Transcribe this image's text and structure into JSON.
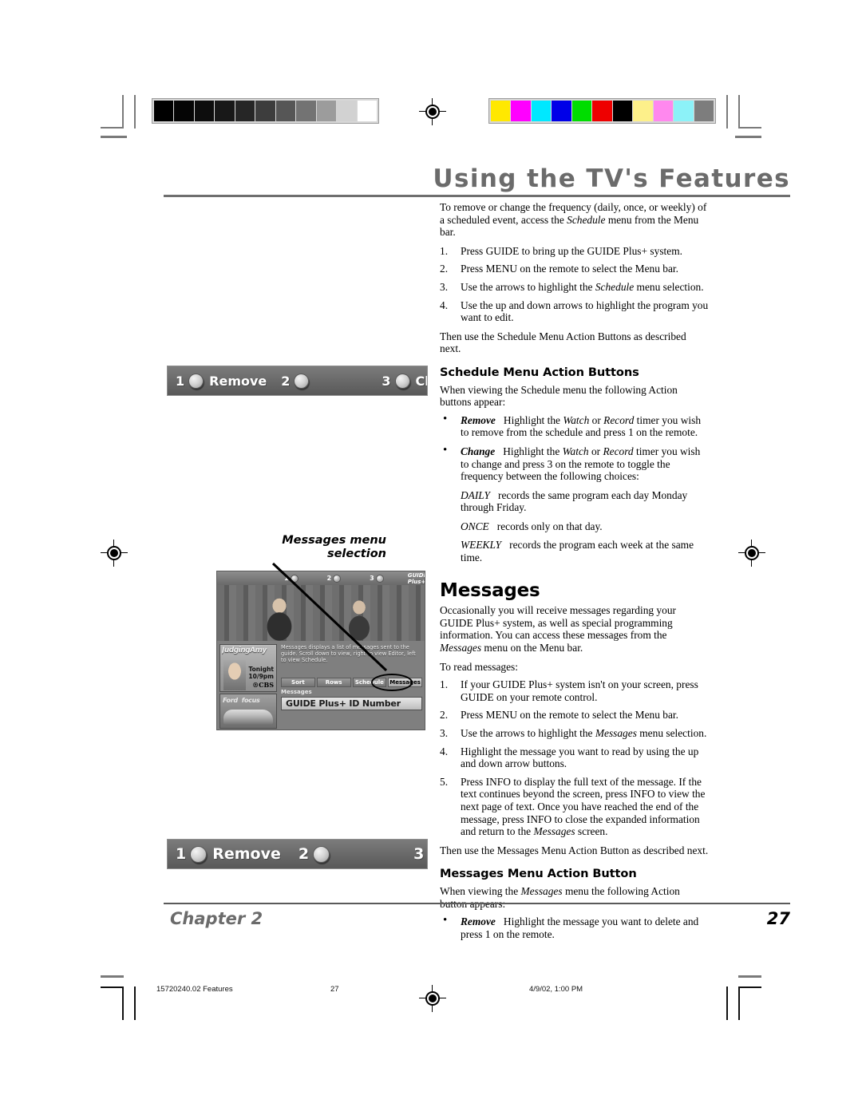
{
  "header": {
    "title": "Using the TV's Features"
  },
  "calibration": {
    "gray_bar": [
      "#000000",
      "#050505",
      "#0d0d0d",
      "#181818",
      "#262626",
      "#3d3d3d",
      "#565656",
      "#737373",
      "#9c9c9c",
      "#d2d2d2",
      "#ffffff"
    ],
    "color_bar": [
      "#ffe800",
      "#ff00ff",
      "#00e8ff",
      "#0000e8",
      "#00dd00",
      "#ee0000",
      "#000000",
      "#fdf08a",
      "#ff88ee",
      "#8cf2f8",
      "#7d7d7d"
    ]
  },
  "intro": {
    "lead_1": "To remove or change the frequency (daily, once, or weekly) of a scheduled event, access the ",
    "lead_1_i": "Schedule",
    "lead_1_end": " menu from the Menu bar.",
    "steps": [
      {
        "num": "1.",
        "text": "Press GUIDE to bring up the GUIDE Plus+ system."
      },
      {
        "num": "2.",
        "text": "Press MENU on the remote to select the Menu bar."
      },
      {
        "num": "3.",
        "text": "Use the arrows to highlight the Schedule menu selection.",
        "pre": "Use the arrows to highlight the ",
        "em": "Schedule",
        "post": " menu selection."
      },
      {
        "num": "4.",
        "text": "Use the up and down arrows to highlight the program you want to edit."
      }
    ],
    "closing": "Then use the Schedule Menu Action Buttons as described next."
  },
  "schedule_section": {
    "heading": "Schedule Menu Action Buttons",
    "intro": "When viewing the Schedule menu the following Action buttons appear:",
    "bullets": [
      {
        "term": "Remove",
        "pre": "Highlight the ",
        "em1": "Watch",
        "mid": " or ",
        "em2": "Record",
        "post": " timer you wish to remove from the schedule and press 1 on the remote."
      },
      {
        "term": "Change",
        "pre": "Highlight the ",
        "em1": "Watch",
        "mid": " or ",
        "em2": "Record",
        "post": " timer you wish to change and press 3 on the remote to toggle the frequency between the following choices:"
      }
    ],
    "choices": [
      {
        "key": "DAILY",
        "text": " records the same program each day Monday through Friday."
      },
      {
        "key": "ONCE",
        "text": " records only on that day."
      },
      {
        "key": "WEEKLY",
        "text": " records the program each week at the same time."
      }
    ]
  },
  "messages_section": {
    "heading": "Messages",
    "intro_pre": "Occasionally you will receive messages regarding your GUIDE Plus+ system, as well as special programming information.  You can access these messages from the ",
    "intro_em": "Messages",
    "intro_post": " menu on the Menu bar.",
    "to_read": "To read messages:",
    "steps": [
      {
        "num": "1.",
        "text": "If your GUIDE Plus+ system isn't on your screen, press GUIDE on your remote control."
      },
      {
        "num": "2.",
        "text": "Press MENU on the remote to select the Menu bar."
      },
      {
        "num": "3.",
        "pre": "Use the arrows to highlight the ",
        "em": "Messages",
        "post": " menu selection."
      },
      {
        "num": "4.",
        "text": "Highlight the message you want to read by using the up and down arrow buttons."
      },
      {
        "num": "5.",
        "pre": "Press INFO to display the full text of the message. If the text continues beyond the screen, press INFO to view the next page of text. Once you have reached the end of the message, press INFO to close the expanded information and return to the ",
        "em": "Messages",
        "post": " screen."
      }
    ],
    "closing": "Then use the Messages Menu Action Button as described next."
  },
  "messages_action_section": {
    "heading": "Messages Menu Action Button",
    "intro_pre": "When viewing the ",
    "intro_em": "Messages",
    "intro_post": " menu the following Action button appears:",
    "bullet": {
      "term": "Remove",
      "text": "Highlight the message you want to delete and press 1 on the remote."
    }
  },
  "action_bar_schedule": {
    "items": [
      {
        "num": "1",
        "label": "Remove",
        "icon": "round-button-icon"
      },
      {
        "num": "2",
        "label": "",
        "icon": "round-button-icon"
      },
      {
        "num": "3",
        "label": "Change",
        "icon": "round-button-icon"
      }
    ]
  },
  "action_bar_messages": {
    "items": [
      {
        "num": "1",
        "label": "Remove",
        "icon": "round-button-icon"
      },
      {
        "num": "2",
        "label": "",
        "icon": "round-button-icon"
      },
      {
        "num": "3",
        "label": "",
        "icon": "round-button-icon"
      }
    ]
  },
  "callout": {
    "line1": "Messages menu",
    "line2": "selection"
  },
  "tv_screenshot": {
    "topbar": [
      {
        "num": "1"
      },
      {
        "num": "2"
      },
      {
        "num": "3"
      }
    ],
    "brand": "GUIDE Plus+",
    "description": "Messages displays a list of messages sent to the guide. Scroll down to view, right to view Editor, left to view Schedule.",
    "menu_items": [
      "Sort",
      "Rows",
      "Schedule",
      "Messages"
    ],
    "selected_menu_item": "Messages",
    "sub_label": "Messages",
    "id_row": "GUIDE Plus+ ID Number",
    "program_logo": "JudgingAmy",
    "program_time_line1": "Tonight",
    "program_time_line2": "10/9pm",
    "program_network": "CBS",
    "ad_brand_1": "Ford",
    "ad_brand_2": "focus"
  },
  "footer": {
    "chapter": "Chapter 2",
    "page_number": "27"
  },
  "print_marks": {
    "file": "15720240.02 Features",
    "page": "27",
    "timestamp": "4/9/02, 1:00 PM"
  }
}
